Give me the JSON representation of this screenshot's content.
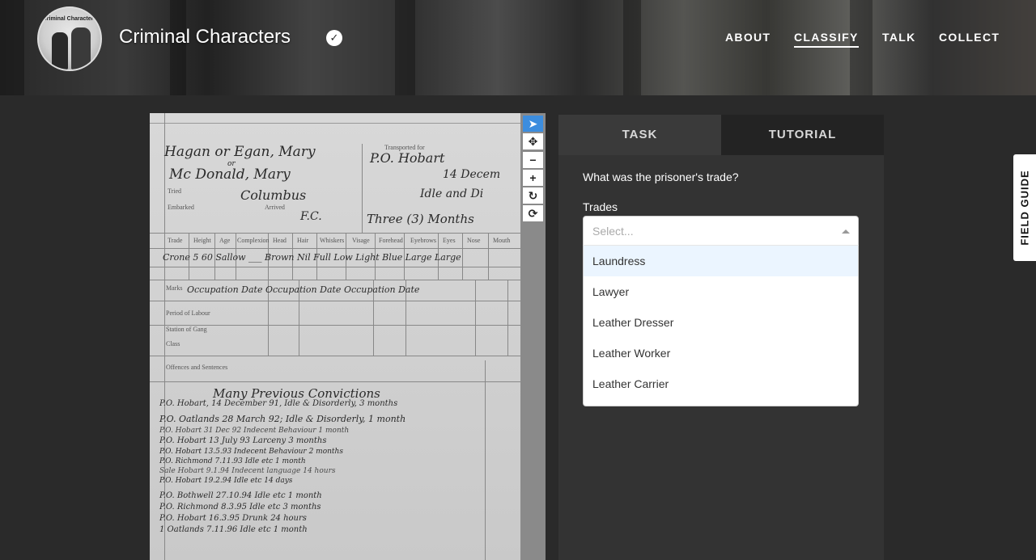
{
  "header": {
    "title": "Criminal Characters",
    "logo_text": "Criminal Characters",
    "nav": [
      {
        "label": "ABOUT",
        "active": false
      },
      {
        "label": "CLASSIFY",
        "active": true
      },
      {
        "label": "TALK",
        "active": false
      },
      {
        "label": "COLLECT",
        "active": false
      }
    ]
  },
  "subject": {
    "handwriting": {
      "name1": "Hagan or Egan, Mary",
      "name_or": "or",
      "name2": "Mc Donald, Mary",
      "trial_place": "Columbus",
      "fc": "F.C.",
      "transported": "P.O. Hobart",
      "date": "14 Decem",
      "sentence": "Idle and Di",
      "term": "Three (3) Months",
      "row": "Crone 5  60  Sallow  ___ Brown Nil Full Low Light Blue Large Large",
      "occ_header": "Occupation  Date  Occupation  Date  Occupation  Date",
      "convictions_title": "Many Previous Convictions",
      "convictions_sub": "P.O. Hobart, 14 December 91, Idle & Disorderly, 3 months",
      "lines": [
        "P.O. Oatlands 28 March 92;  Idle & Disorderly,  1 month",
        "P.O. Hobart 31 Dec 92   Indecent Behaviour  1 month",
        "P.O. Hobart 13 July 93   Larceny   3 months",
        "P.O. Hobart  13.5.93   Indecent Behaviour  2 months",
        "P.O. Richmond  7.11.93   Idle etc   1 month",
        "Sale Hobart  9.1.94   Indecent language   14 hours",
        "P.O. Hobart  19.2.94   Idle etc   14 days",
        "P.O. Bothwell  27.10.94   Idle etc   1 month",
        "P.O. Richmond  8.3.95   Idle etc   3 months",
        "P.O. Hobart  16.3.95   Drunk   24 hours",
        "1  Oatlands  7.11.96   Idle etc   1 month"
      ]
    },
    "printed": {
      "transported_for": "Transported for",
      "tried": "Tried",
      "embarked": "Embarked",
      "arrived": "Arrived",
      "columns": [
        "Trade",
        "Height",
        "Age",
        "Complexion",
        "Head",
        "Hair",
        "Whiskers",
        "Visage",
        "Forehead",
        "Eyebrows",
        "Eyes",
        "Nose",
        "Mouth"
      ],
      "marks": "Marks",
      "period": "Period of Labour",
      "station": "Station of Gang",
      "class": "Class",
      "offences": "Offences and Sentences"
    }
  },
  "toolbar": {
    "tools": [
      {
        "icon": "pointer-icon",
        "glyph": "➤",
        "active": true
      },
      {
        "icon": "move-icon",
        "glyph": "✥",
        "active": false
      },
      {
        "icon": "zoom-out-icon",
        "glyph": "−",
        "active": false
      },
      {
        "icon": "zoom-in-icon",
        "glyph": "+",
        "active": false
      },
      {
        "icon": "rotate-icon",
        "glyph": "↻",
        "active": false
      },
      {
        "icon": "reset-icon",
        "glyph": "⟳",
        "active": false
      }
    ]
  },
  "panel": {
    "tabs": [
      {
        "label": "TASK",
        "active": true
      },
      {
        "label": "TUTORIAL",
        "active": false
      }
    ],
    "question": "What was the prisoner's trade?",
    "field_label": "Trades",
    "placeholder": "Select...",
    "options": [
      {
        "label": "Laundress",
        "focused": true
      },
      {
        "label": "Lawyer",
        "focused": false
      },
      {
        "label": "Leather Dresser",
        "focused": false
      },
      {
        "label": "Leather Worker",
        "focused": false
      },
      {
        "label": "Leather Carrier",
        "focused": false
      }
    ]
  },
  "field_guide": "FIELD GUIDE",
  "colors": {
    "accent": "#3c8dde",
    "panel_bg": "#333333",
    "page_bg": "#2a2a2a",
    "focused_option": "#ebf5ff"
  }
}
